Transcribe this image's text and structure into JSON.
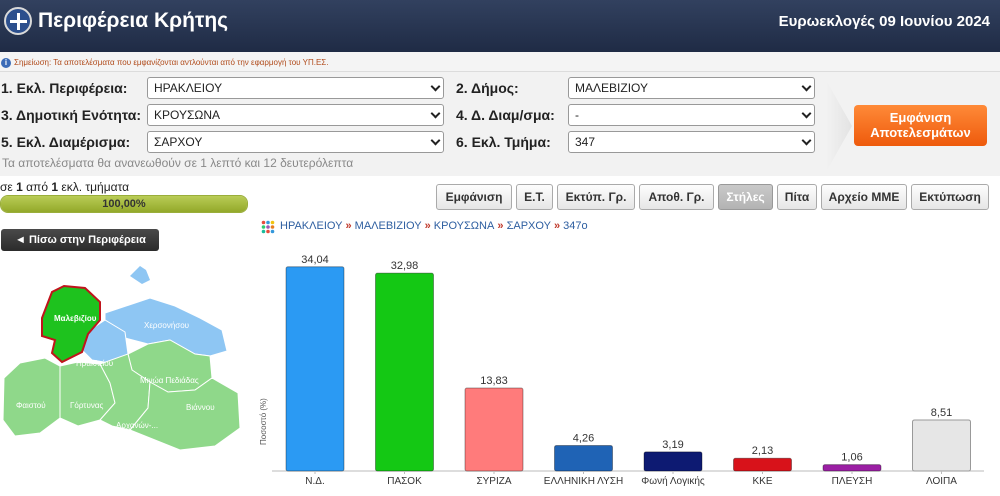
{
  "header": {
    "title": "Περιφέρεια Κρήτης",
    "election": "Ευρωεκλογές 09 Ιουνίου 2024"
  },
  "note": "Σημείωση: Τα αποτελέσματα που εμφανίζονται αντλούνται από την εφαρμογή του ΥΠ.ΕΣ.",
  "filters": {
    "region_label": "1. Εκλ. Περιφέρεια:",
    "region_value": "ΗΡΑΚΛΕΙΟΥ",
    "municipality_label": "2. Δήμος:",
    "municipality_value": "ΜΑΛΕΒΙΖΙΟΥ",
    "unit_label": "3. Δημοτική Ενότητα:",
    "unit_value": "ΚΡΟΥΣΩΝΑ",
    "district_label": "4. Δ. Διαμ/σμα:",
    "district_value": "-",
    "section_label": "5. Εκλ. Διαμέρισμα:",
    "section_value": "ΣΑΡΧΟΥ",
    "station_label": "6. Εκλ. Τμήμα:",
    "station_value": "347",
    "show_button": "Εμφάνιση Αποτελεσμάτων",
    "refresh_text": "Τα αποτελέσματα θα ανανεωθούν σε 1 λεπτό και 12 δευτερόλεπτα"
  },
  "progress": {
    "prefix": "σε ",
    "count": "1",
    "middle": " από ",
    "total": "1",
    "suffix": " εκλ. τμήματα",
    "percent_text": "100,00%",
    "fraction": 1.0
  },
  "view_buttons": [
    {
      "label": "Εμφάνιση",
      "active": false
    },
    {
      "label": "Ε.Τ.",
      "active": false
    },
    {
      "label": "Εκτύπ. Γρ.",
      "active": false
    },
    {
      "label": "Αποθ. Γρ.",
      "active": false
    },
    {
      "label": "Στήλες",
      "active": true
    },
    {
      "label": "Πίτα",
      "active": false
    },
    {
      "label": "Αρχείο ΜΜΕ",
      "active": false
    },
    {
      "label": "Εκτύπωση",
      "active": false
    }
  ],
  "back_button": "◄ Πίσω στην Περιφέρεια",
  "map": {
    "selected": "Μαλεβιζίου",
    "labels": [
      "Χερσονήσου",
      "Ηρακλείου",
      "Μινώα Πεδιάδας",
      "Φαιστού",
      "Γόρτυνας",
      "Βιάννου",
      "Αρχανών-..."
    ],
    "colors": {
      "selected": "#1ec21e",
      "highlight": "#8ec6f3",
      "other": "#8fd88a"
    }
  },
  "breadcrumb": [
    "ΗΡΑΚΛΕΙΟΥ",
    "ΜΑΛΕΒΙΖΙΟΥ",
    "ΚΡΟΥΣΩΝΑ",
    "ΣΑΡΧΟΥ",
    "347ο"
  ],
  "breadcrumb_sep": "»",
  "chart_data": {
    "type": "bar",
    "categories": [
      "Ν.Δ.",
      "ΠΑΣΟΚ",
      "ΣΥΡΙΖΑ",
      "ΕΛΛΗΝΙΚΗ ΛΥΣΗ",
      "Φωνή Λογικής",
      "ΚΚΕ",
      "ΠΛΕΥΣΗ",
      "ΛΟΙΠΑ"
    ],
    "values": [
      34.04,
      32.98,
      13.83,
      4.26,
      3.19,
      2.13,
      1.06,
      8.51
    ],
    "value_labels": [
      "34,04",
      "32,98",
      "13,83",
      "4,26",
      "3,19",
      "2,13",
      "1,06",
      "8,51"
    ],
    "colors": [
      "#2b9af3",
      "#14c814",
      "#ff7b7b",
      "#1f63b5",
      "#0d1a72",
      "#d8121a",
      "#9b1fa4",
      "#e6e6e6"
    ],
    "ylabel": "Ποσοστό (%)",
    "ylim": [
      0,
      36
    ],
    "grid": false
  }
}
